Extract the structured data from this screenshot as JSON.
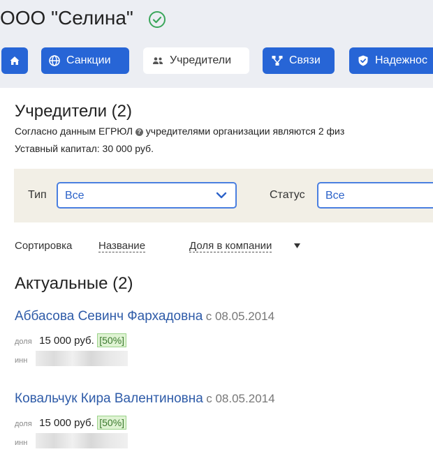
{
  "company": {
    "title": "ООО \"Селина\""
  },
  "tabs": [
    {
      "label": "",
      "icon": "home-icon"
    },
    {
      "label": "Санкции",
      "icon": "globe-icon"
    },
    {
      "label": "Учредители",
      "icon": "users-icon"
    },
    {
      "label": "Связи",
      "icon": "network-icon"
    },
    {
      "label": "Надежнос",
      "icon": "shield-icon"
    }
  ],
  "founders_section": {
    "title": "Учредители (2)",
    "desc_before": "Согласно данным ЕГРЮЛ",
    "desc_after": "учредителями организации являются 2 физ",
    "capital": "Уставный капитал: 30 000 руб."
  },
  "filters": {
    "type_label": "Тип",
    "type_value": "Все",
    "status_label": "Статус",
    "status_value": "Все"
  },
  "sort": {
    "label": "Сортировка",
    "by_name": "Название",
    "by_share": "Доля в компании"
  },
  "current": {
    "title": "Актуальные (2)",
    "founders": [
      {
        "name": "Аббасова Севинч Фархадовна",
        "date": "с 08.05.2014",
        "share_label": "доля",
        "share": "15 000 руб.",
        "percent": "[50%]",
        "inn_label": "инн"
      },
      {
        "name": "Ковальчук Кира Валентиновна",
        "date": "с 08.05.2014",
        "share_label": "доля",
        "share": "15 000 руб.",
        "percent": "[50%]",
        "inn_label": "инн"
      }
    ]
  },
  "colors": {
    "accent": "#2765d6",
    "link": "#2e5ba8",
    "filter_bg": "#f2efe6",
    "verified": "#3aa65a"
  }
}
